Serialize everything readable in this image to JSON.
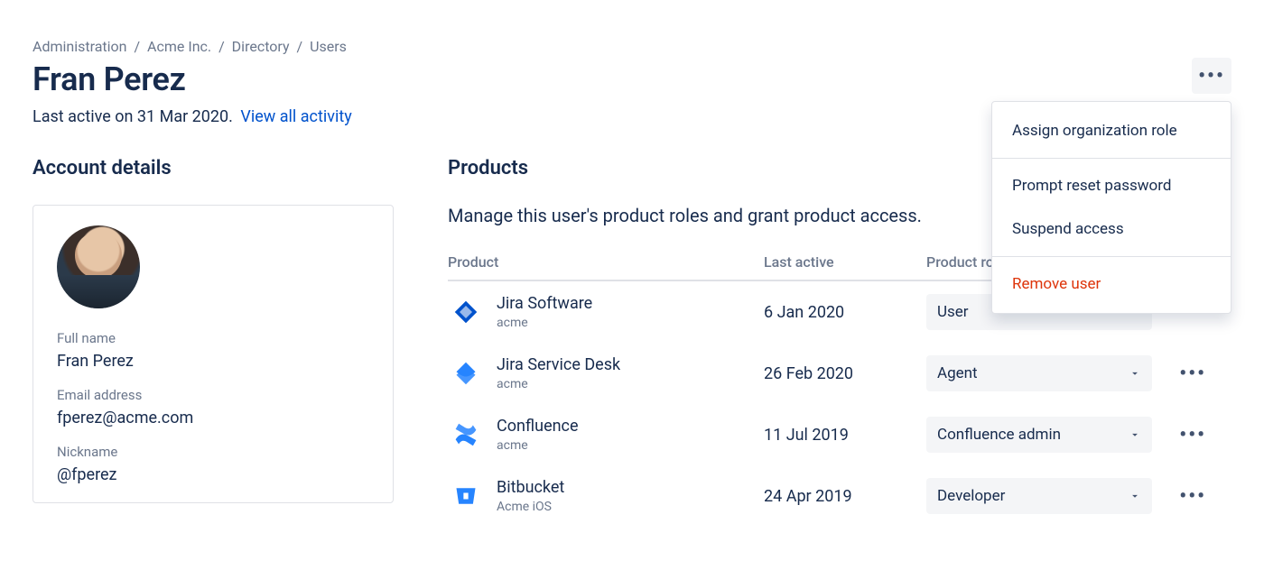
{
  "breadcrumb": {
    "administration": "Administration",
    "org": "Acme Inc.",
    "directory": "Directory",
    "users": "Users"
  },
  "page_title": "Fran Perez",
  "activity": {
    "prefix": "Last active on ",
    "date": "31 Mar 2020",
    "link_label": "View all activity"
  },
  "headings": {
    "account_details": "Account details",
    "products": "Products"
  },
  "account": {
    "labels": {
      "full_name": "Full name",
      "email": "Email address",
      "nickname": "Nickname"
    },
    "full_name": "Fran Perez",
    "email": "fperez@acme.com",
    "nickname": "@fperez"
  },
  "products_section": {
    "description": "Manage this user's product roles and grant product access.",
    "columns": {
      "product": "Product",
      "last_active": "Last active",
      "product_role": "Product role"
    },
    "rows": [
      {
        "icon": "jira-software",
        "icon_color": "#0052CC",
        "name": "Jira Software",
        "sub": "acme",
        "last_active": "6 Jan 2020",
        "role": "User"
      },
      {
        "icon": "jira-service-desk",
        "icon_color": "#2684FF",
        "name": "Jira Service Desk",
        "sub": "acme",
        "last_active": "26 Feb 2020",
        "role": "Agent"
      },
      {
        "icon": "confluence",
        "icon_color": "#2684FF",
        "name": "Confluence",
        "sub": "acme",
        "last_active": "11 Jul 2019",
        "role": "Confluence admin"
      },
      {
        "icon": "bitbucket",
        "icon_color": "#2684FF",
        "name": "Bitbucket",
        "sub": "Acme iOS",
        "last_active": "24 Apr 2019",
        "role": "Developer"
      }
    ]
  },
  "menu": {
    "assign_role": "Assign organization role",
    "reset_password": "Prompt reset password",
    "suspend": "Suspend access",
    "remove": "Remove user"
  }
}
